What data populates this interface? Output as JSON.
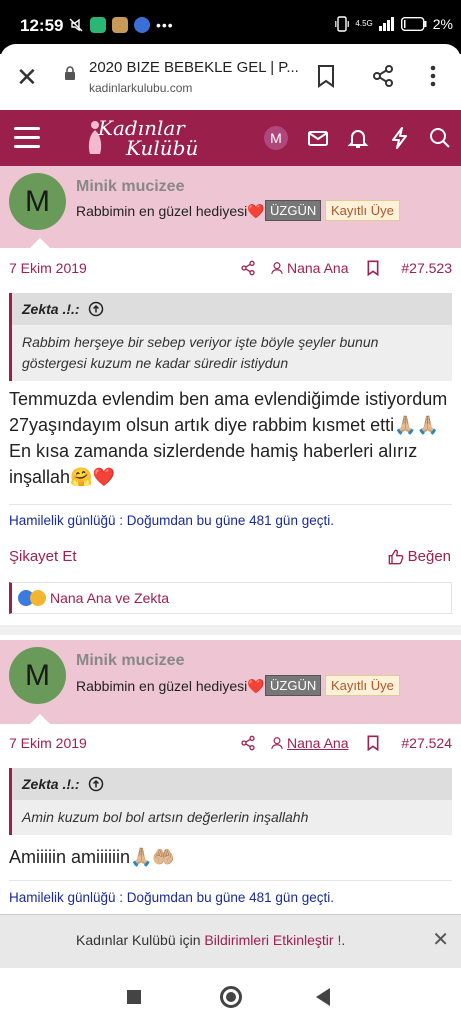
{
  "status_bar": {
    "time": "12:59",
    "network": "4.5G",
    "battery": "2%"
  },
  "browser": {
    "page_title": "2020 BIZE BEBEKLE GEL | P...",
    "url": "kadinlarkulubu.com"
  },
  "forum": {
    "logo_line1": "Kadınlar",
    "logo_line2": "Kulübü",
    "avatar_letter": "M",
    "accent_color": "#9a1f4a"
  },
  "posts": [
    {
      "avatar_letter": "M",
      "username": "Minik mucizee",
      "user_title": "Rabbimin en güzel hediyesi❤️",
      "badge1": "ÜZGÜN",
      "badge2": "Kayıtlı Üye",
      "date": "7 Ekim 2019",
      "author": "Nana Ana",
      "post_number": "#27.523",
      "quote_author": "Zekta .!.:",
      "quote_text": "Rabbim herşeye bir sebep veriyor işte böyle şeyler bunun göstergesi kuzum ne kadar süredir istiydun",
      "body_lines": [
        "Temmuzda evlendim ben ama evlendiğimde istiyordum",
        "27yaşındayım olsun artık diye rabbim kısmet etti🙏🏼🙏🏼",
        "En kısa zamanda sizlerdende hamiş haberleri alırız",
        "inşallah🤗❤️"
      ],
      "signature": "Hamilelik günlüğü : Doğumdan bu güne 481 gün geçti.",
      "report_label": "Şikayet Et",
      "like_label": "Beğen",
      "reactions_text": "Nana Ana ve Zekta"
    },
    {
      "avatar_letter": "M",
      "username": "Minik mucizee",
      "user_title": "Rabbimin en güzel hediyesi❤️",
      "badge1": "ÜZGÜN",
      "badge2": "Kayıtlı Üye",
      "date": "7 Ekim 2019",
      "author": "Nana Ana",
      "post_number": "#27.524",
      "quote_author": "Zekta .!.:",
      "quote_text": "Amin kuzum bol bol artsın değerlerin inşallahh",
      "body_lines": [
        "Amiiiiin amiiiiiin🙏🏼🤲🏼"
      ],
      "signature": "Hamilelik günlüğü : Doğumdan bu güne 481 gün geçti."
    }
  ],
  "notification": {
    "prefix": "Kadınlar Kulübü için ",
    "link": "Bildirimleri Etkinleştir !",
    "suffix": "."
  },
  "icons": {
    "close": "close-icon",
    "bookmark": "bookmark-icon",
    "share": "share-icon",
    "more": "more-vertical-icon",
    "mail": "mail-icon",
    "bell": "bell-icon",
    "bolt": "bolt-icon",
    "search": "search-icon"
  }
}
